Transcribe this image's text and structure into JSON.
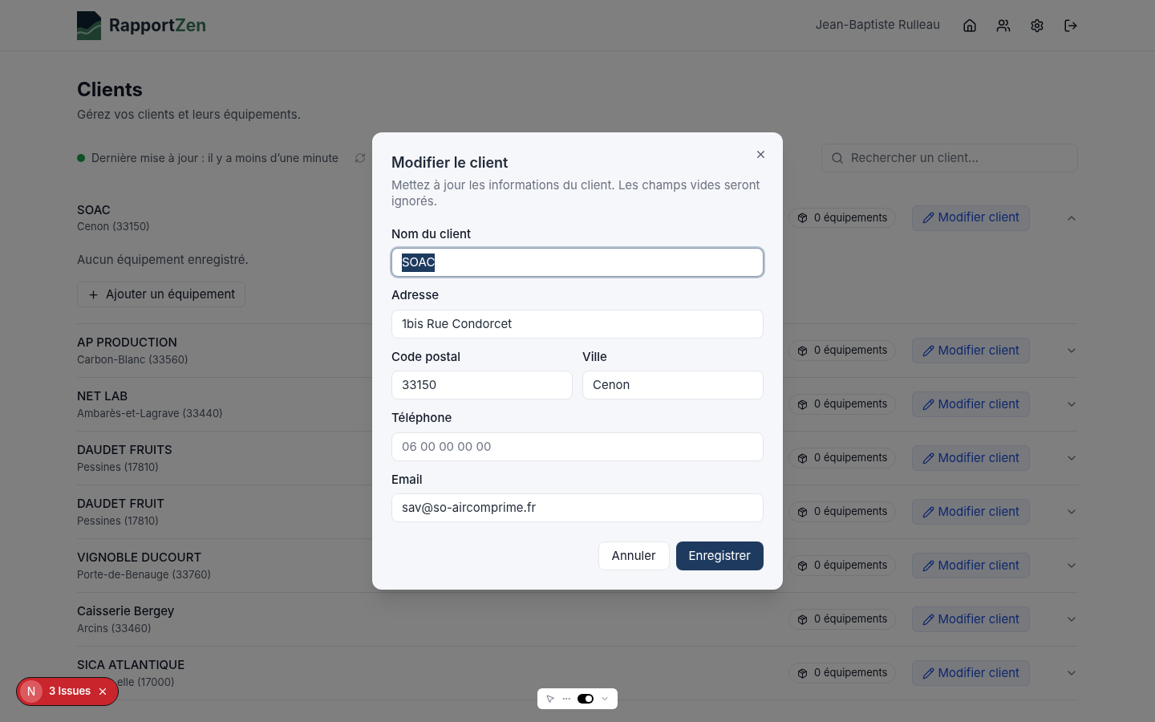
{
  "header": {
    "logo_text": "Rapport",
    "logo_accent": "Zen",
    "user": "Jean-Baptiste Rulleau"
  },
  "page": {
    "title": "Clients",
    "subtitle": "Gérez vos clients et leurs équipements.",
    "status": "Dernière mise à jour : il y a moins d’une minute",
    "search_placeholder": "Rechercher un client..."
  },
  "clients": [
    {
      "name": "SOAC",
      "city": "Cenon (33150)",
      "equipments": "0 équipements",
      "edit": "Modifier client",
      "covered": false,
      "expanded": true,
      "empty_text": "Aucun équipement enregistré.",
      "add_button": "Ajouter un équipement"
    },
    {
      "name": "AP PRODUCTION",
      "city": "Carbon-Blanc (33560)",
      "covered": false,
      "equipments": "0 équipements",
      "edit": "Modifier client",
      "expanded": false
    },
    {
      "name": "NET LAB",
      "city": "Ambarès-et-Lagrave (33440)",
      "covered": false,
      "equipments": "0 équipements",
      "edit": "Modifier client",
      "expanded": false
    },
    {
      "name": "DAUDET FRUITS",
      "city": "Pessines (17810)",
      "covered": false,
      "equipments": "0 équipements",
      "edit": "Modifier client",
      "expanded": false
    },
    {
      "name": "DAUDET FRUIT",
      "city": "Pessines (17810)",
      "covered": false,
      "equipments": "0 équipements",
      "edit": "Modifier client",
      "expanded": false
    },
    {
      "name": "VIGNOBLE DUCOURT",
      "city": "Porte-de-Benauge (33760)",
      "covered": false,
      "equipments": "0 équipements",
      "edit": "Modifier client",
      "expanded": false
    },
    {
      "name": "Caisserie Bergey",
      "city": "Arcins (33460)",
      "covered": false,
      "equipments": "0 équipements",
      "edit": "Modifier client",
      "expanded": false
    },
    {
      "name": "SICA ATLANTIQUE",
      "city": "elle (17000)",
      "covered": true,
      "equipments": "0 équipements",
      "edit": "Modifier client",
      "expanded": false
    }
  ],
  "dialog": {
    "title": "Modifier le client",
    "description": "Mettez à jour les informations du client. Les champs vides seront ignorés.",
    "fields": [
      {
        "label": "Nom du client",
        "value": "SOAC",
        "focused": true,
        "text_selected": true
      },
      {
        "label": "Adresse",
        "value": "1bis Rue Condorcet",
        "focused": false
      },
      {
        "label": "Code postal",
        "value": "33150",
        "focused": false,
        "half": true
      },
      {
        "label": "Ville",
        "value": "Cenon",
        "focused": false,
        "half": true
      },
      {
        "label": "Téléphone",
        "placeholder": "06 00 00 00 00",
        "focused": false
      },
      {
        "label": "Email",
        "value": "sav@so-aircomprime.fr",
        "focused": false
      }
    ],
    "cancel": "Annuler",
    "save": "Enregistrer"
  },
  "dev": {
    "issues_logo": "N",
    "issues": "3 Issues",
    "toggle_on": true
  }
}
